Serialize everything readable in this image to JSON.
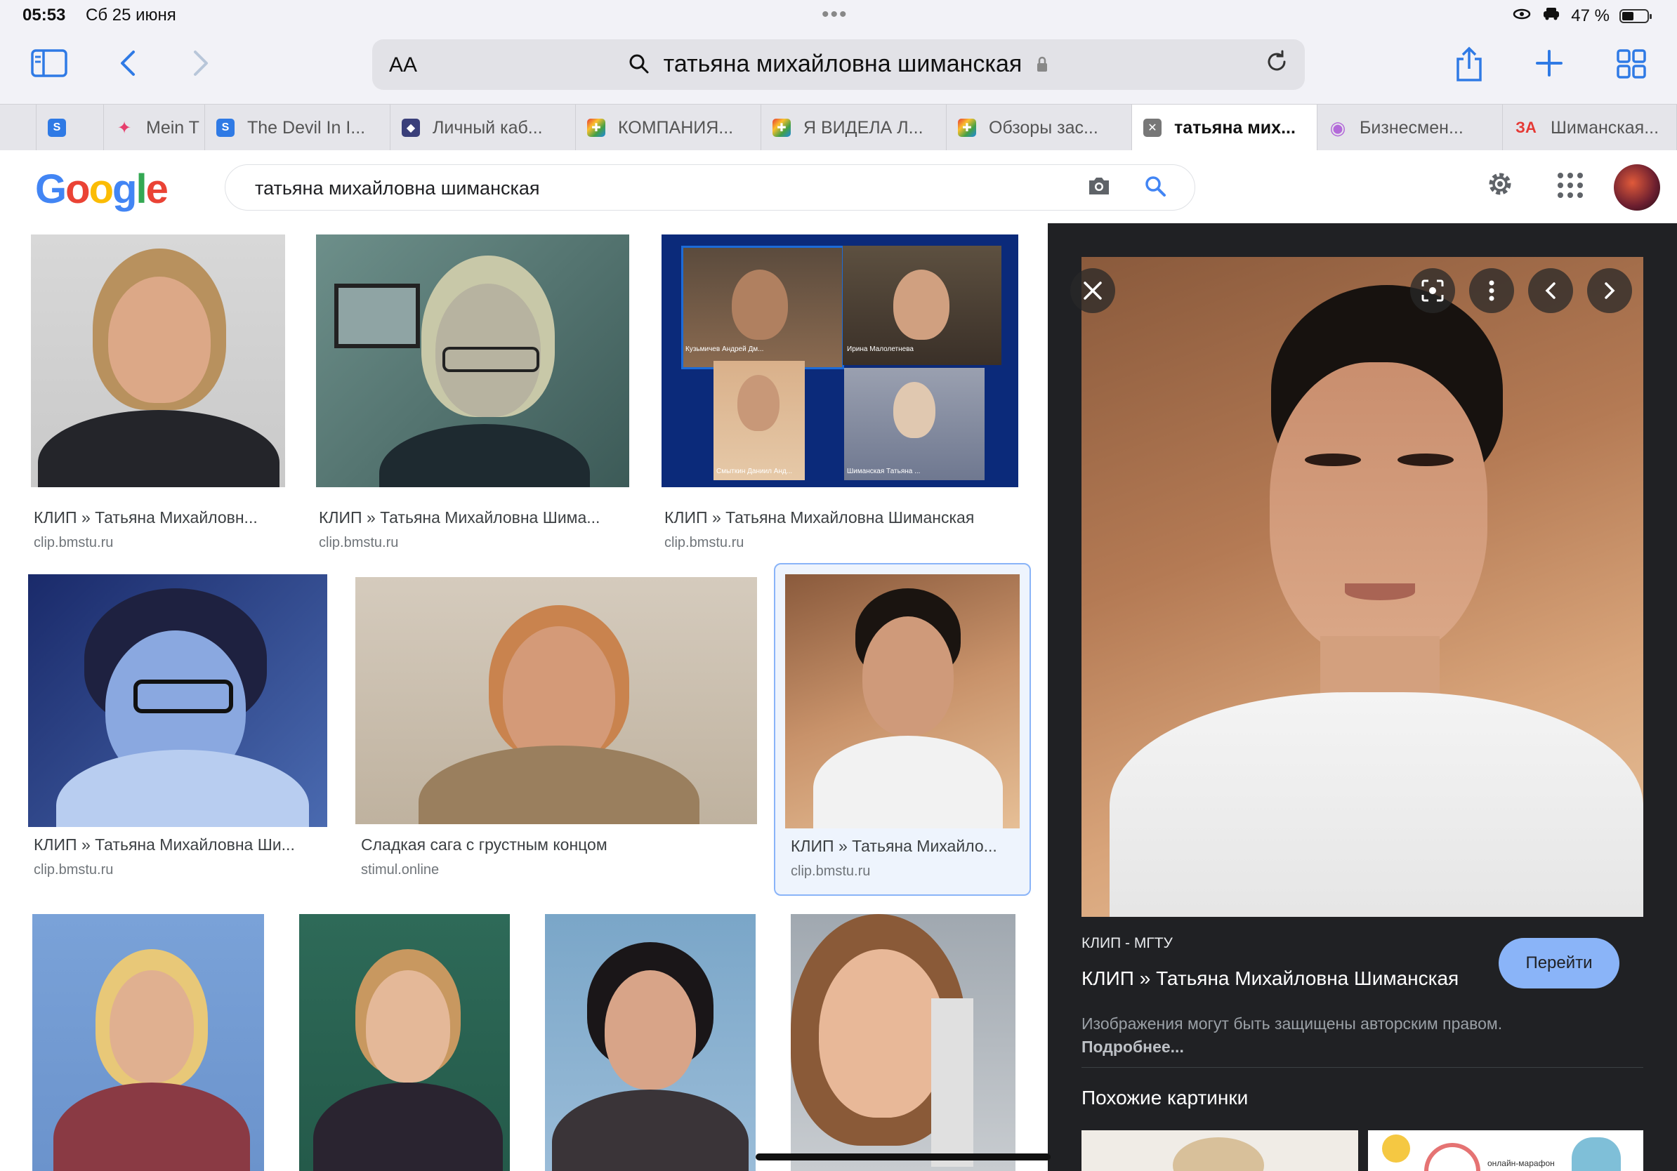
{
  "status_bar": {
    "time": "05:53",
    "date": "Сб 25 июня",
    "battery": "47 %"
  },
  "toolbar": {
    "text_size": "AA",
    "url_text": "татьяна михайловна шиманская"
  },
  "tabs": [
    {
      "label": "",
      "fav_color": "#2f7ae5",
      "fav_glyph": ""
    },
    {
      "label": "Mein T",
      "fav_color": "#e63e6d",
      "fav_glyph": "✦"
    },
    {
      "label": "The Devil In I...",
      "fav_color": "#2f7ae5",
      "fav_glyph": "S"
    },
    {
      "label": "Личный каб...",
      "fav_color": "#3a3f7a",
      "fav_glyph": "◆"
    },
    {
      "label": "КОМПАНИЯ...",
      "fav_color": "#7b4fd6",
      "fav_glyph": "✚"
    },
    {
      "label": "Я ВИДЕЛА Л...",
      "fav_color": "#7b4fd6",
      "fav_glyph": "✚"
    },
    {
      "label": "Обзоры зас...",
      "fav_color": "#7b4fd6",
      "fav_glyph": "✚"
    },
    {
      "label": "татьяна мих...",
      "fav_color": "#555555",
      "fav_glyph": "✕"
    },
    {
      "label": "Бизнесмен...",
      "fav_color": "#b36ad9",
      "fav_glyph": "◉"
    },
    {
      "label": "Шиманская...",
      "fav_color": "#ffffff",
      "fav_glyph": "ЗА"
    }
  ],
  "google": {
    "logo": [
      "G",
      "o",
      "o",
      "g",
      "l",
      "e"
    ],
    "search_value": "татьяна михайловна шиманская"
  },
  "results": [
    {
      "title": "КЛИП » Татьяна Михайловн...",
      "site": "clip.bmstu.ru"
    },
    {
      "title": "КЛИП » Татьяна Михайловна Шима...",
      "site": "clip.bmstu.ru"
    },
    {
      "title": "КЛИП » Татьяна Михайловна Шиманская",
      "site": "clip.bmstu.ru"
    },
    {
      "title": "КЛИП » Татьяна Михайловна Ши...",
      "site": "clip.bmstu.ru"
    },
    {
      "title": "Сладкая сага с грустным концом",
      "site": "stimul.online"
    },
    {
      "title": "КЛИП » Татьяна Михайло...",
      "site": "clip.bmstu.ru"
    }
  ],
  "video_thumb": {
    "names": [
      "Кузьмичев Андрей Дм...",
      "Ирина Малолетнева",
      "Смыткин Даниил Анд...",
      "Шиманская Татьяна ..."
    ]
  },
  "preview": {
    "source": "КЛИП - МГТУ",
    "title": "КЛИП » Татьяна Михайловна Шиманская",
    "go_label": "Перейти",
    "note": "Изображения могут быть защищены авторским правом.",
    "note_link": "Подробнее...",
    "similar_heading": "Похожие картинки",
    "similar_thumb_text": "онлайн-марафон"
  }
}
